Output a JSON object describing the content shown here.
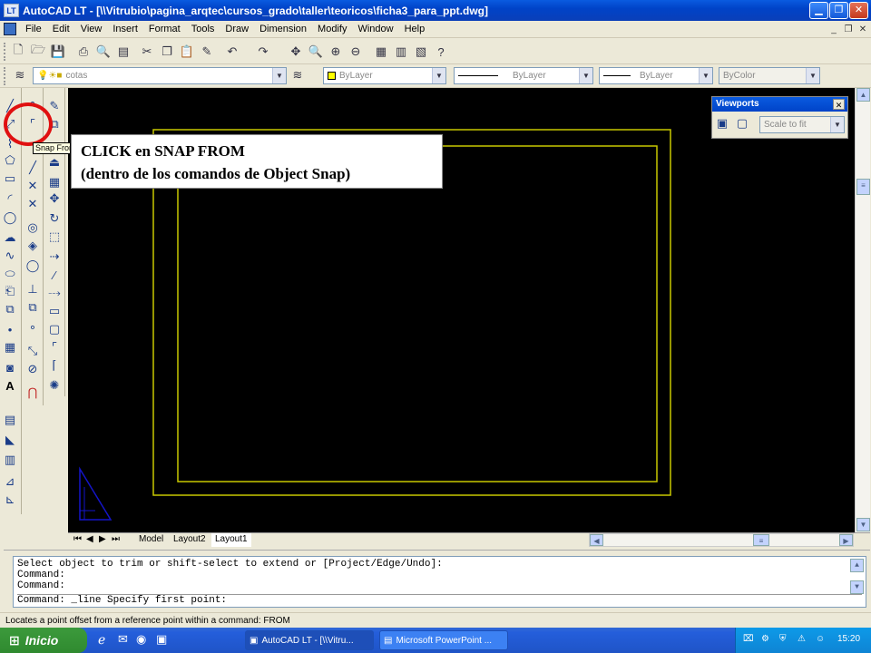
{
  "window": {
    "title": "AutoCAD LT - [\\\\Vitrubio\\pagina_arqtec\\cursos_grado\\taller\\teoricos\\ficha3_para_ppt.dwg]",
    "app_badge": "LT"
  },
  "menu": [
    "File",
    "Edit",
    "View",
    "Insert",
    "Format",
    "Tools",
    "Draw",
    "Dimension",
    "Modify",
    "Window",
    "Help"
  ],
  "layers": {
    "layer_combo": "cotas",
    "color_combo": "ByLayer",
    "linetype_combo": "ByLayer",
    "lineweight_combo": "ByLayer",
    "plotstyle_combo": "ByColor"
  },
  "viewports_palette": {
    "title": "Viewports",
    "scale_combo": "Scale to fit"
  },
  "tooltip": "Snap From",
  "annotation": {
    "line1": "CLICK en SNAP FROM",
    "line2": "(dentro de los comandos de Object Snap)"
  },
  "tabs": [
    {
      "label": "Model"
    },
    {
      "label": "Layout2"
    },
    {
      "label": "Layout1",
      "active": true
    }
  ],
  "command_lines": [
    "Select object to trim or shift-select to extend or [Project/Edge/Undo]:",
    "Command:",
    "Command:",
    "Command: _line Specify first point:"
  ],
  "status_text": "Locates a point offset from a reference point within a command:  FROM",
  "taskbar": {
    "start_label": "Inicio",
    "buttons": [
      "AutoCAD LT - [\\\\Vitru...",
      "Microsoft PowerPoint ..."
    ],
    "clock": "15:20"
  },
  "colors": {
    "canvas": "#000000",
    "border": "#c8c800",
    "ucs": "#1414c8",
    "highlight_ring": "#e01010"
  }
}
